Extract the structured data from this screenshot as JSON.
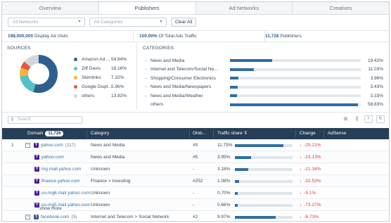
{
  "tabs": [
    {
      "label": "Overview"
    },
    {
      "label": "Publishers"
    },
    {
      "label": "Ad Networks"
    },
    {
      "label": "Creatives"
    }
  ],
  "filters": {
    "networks_placeholder": "All Networks",
    "categories_placeholder": "All Categories",
    "clear_label": "Clear All"
  },
  "summary": {
    "visits_value": "198,000,000",
    "visits_label": "Display Ad Visits",
    "traffic_value": "100.00%",
    "traffic_label": "Of Total Ads Traffic",
    "publishers_value": "11,728",
    "publishers_label": "Publishers"
  },
  "sources": {
    "title": "SOURCES",
    "items": [
      {
        "name": "Amazon Ad ...",
        "value": "54.64%",
        "share": 54.64,
        "color": "#2f5f8f"
      },
      {
        "name": "Ziff Davis",
        "value": "18.16%",
        "share": 18.16,
        "color": "#55c1c4"
      },
      {
        "name": "Skimlinks",
        "value": "7.32%",
        "share": 7.32,
        "color": "#f0b43c"
      },
      {
        "name": "Google Displ...",
        "value": "5.96%",
        "share": 5.96,
        "color": "#e8553e"
      },
      {
        "name": "others",
        "value": "13.92%",
        "share": 13.92,
        "color": "#d1d7dd"
      }
    ]
  },
  "categories": {
    "title": "CATEGORIES",
    "items": [
      {
        "name": "News and Media",
        "value": "19.42%",
        "share": 19.42
      },
      {
        "name": "Internet and Telecom/Social Ne...",
        "value": "11.03%",
        "share": 11.03
      },
      {
        "name": "Shopping/Consumer Electronics",
        "value": "3.96%",
        "share": 3.96
      },
      {
        "name": "News and Media/Newspapers",
        "value": "3.43%",
        "share": 3.43
      },
      {
        "name": "News and Media/Weather",
        "value": "3.33%",
        "share": 3.33
      },
      {
        "name": "others",
        "value": "58.83%",
        "share": 58.83
      }
    ]
  },
  "toolbar": {
    "search_placeholder": "Search"
  },
  "table": {
    "headers": {
      "domain": "Domain",
      "domain_count": "11,728",
      "category": "Category",
      "global": "Glob...",
      "traffic_share": "Traffic share",
      "change": "Change",
      "adsense": "AdSense"
    },
    "rows": [
      {
        "num": "1",
        "domain": "yahoo.com",
        "count": "(117)",
        "category": "News and Media",
        "global": "#5",
        "share": "11.75%",
        "share_pct": 11.75,
        "change": "-25.21%"
      },
      {
        "num": "",
        "domain": "yahoo.com",
        "count": "",
        "category": "News and Media",
        "global": "#5",
        "share": "3.95%",
        "share_pct": 3.95,
        "change": "-23.13%"
      },
      {
        "num": "",
        "domain": "mg.mail.yahoo.com",
        "count": "",
        "category": "Unknown",
        "global": "-",
        "share": "3.18%",
        "share_pct": 3.18,
        "change": "-21.34%"
      },
      {
        "num": "",
        "domain": "finance.yahoo.com",
        "count": "",
        "category": "Finance > Investing",
        "global": "#252",
        "share": "1.08%",
        "share_pct": 1.08,
        "change": "-32.53%"
      },
      {
        "num": "",
        "domain": "us-mg6.mail.yahoo.com",
        "count": "",
        "category": "Unknown",
        "global": "-",
        "share": "0.70%",
        "share_pct": 0.7,
        "change": "-5.1%"
      },
      {
        "num": "",
        "domain": "us-mg5.mail.yahoo.com",
        "count": "",
        "category": "Unknown",
        "global": "-",
        "share": "0.66%",
        "share_pct": 0.66,
        "change": "-73.27%"
      },
      {
        "num": "",
        "domain": "facebook.com",
        "count": "(5)",
        "category": "Internet and Telecom > Social Network",
        "global": "#2",
        "share": "9.97%",
        "share_pct": 9.97,
        "change": "-8.73%"
      }
    ],
    "show_more": "show more"
  }
}
